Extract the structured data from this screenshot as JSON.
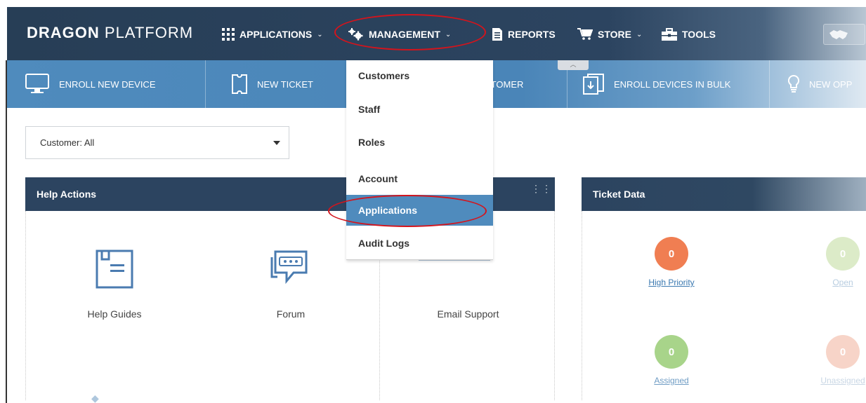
{
  "topnav": {
    "brand_bold": "DRAGON",
    "brand_light": " PLATFORM",
    "items": [
      {
        "label": "APPLICATIONS",
        "icon": "grid-icon",
        "has_chevron": true
      },
      {
        "label": "MANAGEMENT",
        "icon": "gears-icon",
        "has_chevron": true
      },
      {
        "label": "REPORTS",
        "icon": "document-icon",
        "has_chevron": false
      },
      {
        "label": "STORE",
        "icon": "cart-icon",
        "has_chevron": true
      },
      {
        "label": "TOOLS",
        "icon": "toolbox-icon",
        "has_chevron": false
      }
    ],
    "chevron": "⌄"
  },
  "actions": [
    {
      "label": "ENROLL NEW DEVICE",
      "icon": "monitor-icon"
    },
    {
      "label": "NEW TICKET",
      "icon": "ticket-icon"
    },
    {
      "label": "STOMER",
      "icon": ""
    },
    {
      "label": "ENROLL DEVICES IN BULK",
      "icon": "bulk-enroll-icon"
    },
    {
      "label": "NEW OPP",
      "icon": "lightbulb-icon"
    }
  ],
  "management_menu": {
    "items": [
      {
        "label": "Customers",
        "active": false
      },
      {
        "label": "Staff",
        "active": false
      },
      {
        "label": "Roles",
        "active": false
      },
      {
        "label": "Account",
        "active": false
      },
      {
        "label": "Applications",
        "active": true
      },
      {
        "label": "Audit Logs",
        "active": false
      }
    ]
  },
  "customer_filter": {
    "value": "Customer: All"
  },
  "help_actions": {
    "title": "Help Actions",
    "tiles": [
      {
        "label": "Help Guides",
        "icon": "book-icon"
      },
      {
        "label": "Forum",
        "icon": "chat-bubble-icon"
      },
      {
        "label": "Email Support",
        "icon": "email-icon"
      }
    ]
  },
  "ticket_data": {
    "title": "Ticket Data",
    "stats": [
      {
        "label": "High Priority",
        "value": "0",
        "color": "#f07e52",
        "label_color": "#3a78b0"
      },
      {
        "label": "Open",
        "value": "0",
        "color": "#dcebc8",
        "label_color": "#b8cde0"
      },
      {
        "label": "Assigned",
        "value": "0",
        "color": "#a8d48a",
        "label_color": "#6f9cc4"
      },
      {
        "label": "Unassigned",
        "value": "0",
        "color": "#f7d4c8",
        "label_color": "#c8d6e4"
      }
    ]
  },
  "colors": {
    "topbar": "#273e56",
    "actionbar": "#4f8bbd",
    "highlight_oval": "#d4141c",
    "menu_active": "#4f8bbd"
  }
}
